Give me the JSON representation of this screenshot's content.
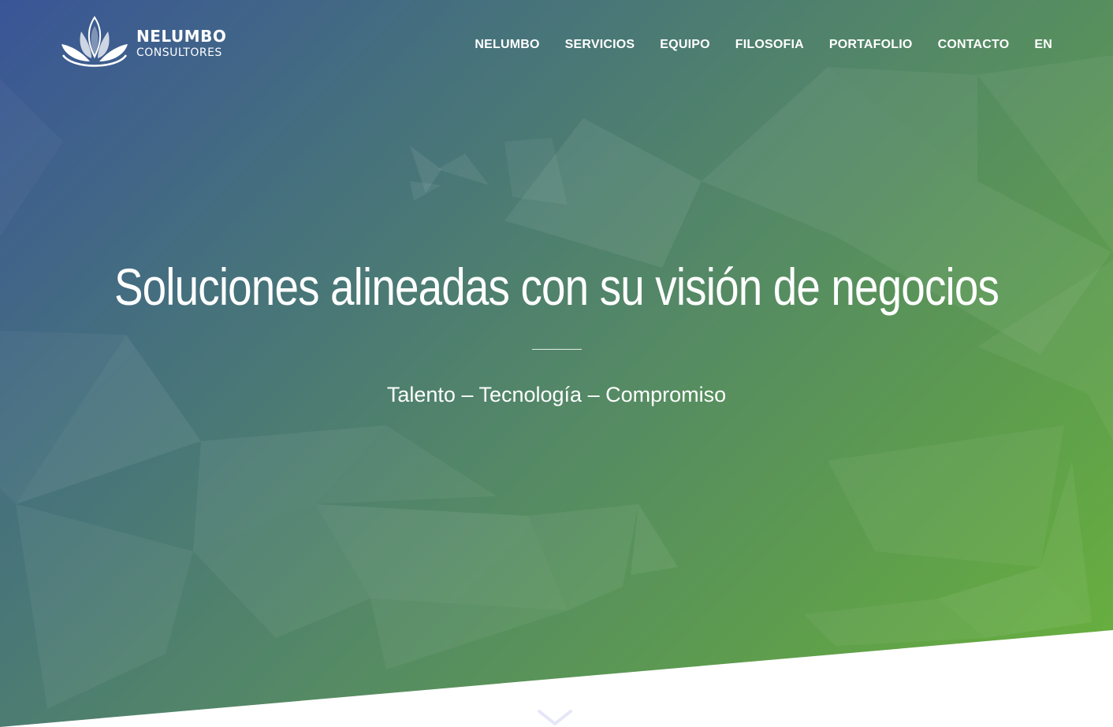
{
  "header": {
    "logo": {
      "name": "NELUMBO",
      "subtitle": "CONSULTORES",
      "icon": "lotus-icon"
    },
    "nav": [
      {
        "label": "NELUMBO"
      },
      {
        "label": "SERVICIOS"
      },
      {
        "label": "EQUIPO"
      },
      {
        "label": "FILOSOFIA"
      },
      {
        "label": "PORTAFOLIO"
      },
      {
        "label": "CONTACTO"
      },
      {
        "label": "EN"
      }
    ]
  },
  "hero": {
    "headline": "Soluciones alineadas con su visión de negocios",
    "tagline": "Talento – Tecnología – Compromiso",
    "scroll_icon": "chevron-down-icon"
  },
  "colors": {
    "gradient_start": "#3a5597",
    "gradient_mid": "#558a64",
    "gradient_end": "#6ab33c",
    "text": "#ffffff",
    "chevron": "#e6e6fa"
  }
}
